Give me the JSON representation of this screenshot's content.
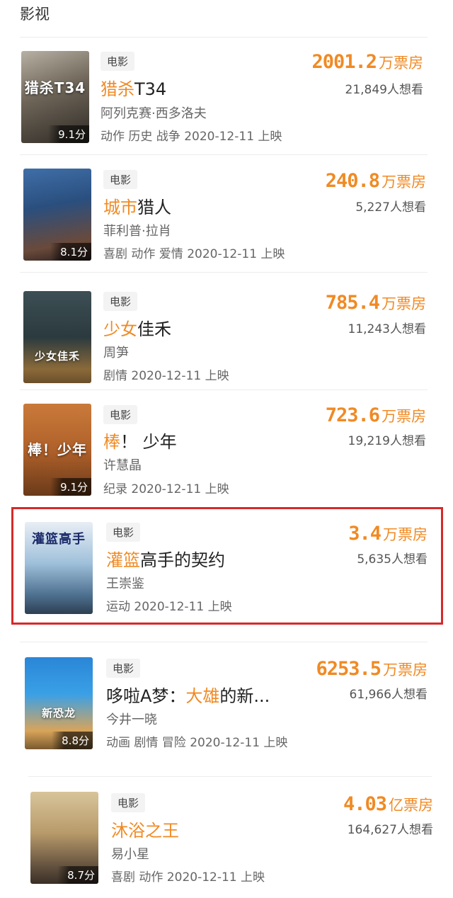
{
  "section": {
    "title": "影视"
  },
  "accent_color": "#f08a24",
  "highlight_color": "#d62a2a",
  "movies": [
    {
      "tag": "电影",
      "title_hl": "猎杀",
      "title_rest": "T34",
      "person": "阿列克赛·西多洛夫",
      "meta": "动作 历史 战争 2020-12-11 上映",
      "box_value": "2001.2",
      "box_unit": "万票房",
      "want": "21,849人想看",
      "rating": "9.1分",
      "poster_text": "猎杀T34"
    },
    {
      "tag": "电影",
      "title_hl": "城市",
      "title_rest": "猎人",
      "person": "菲利普·拉肖",
      "meta": "喜剧 动作 爱情 2020-12-11 上映",
      "box_value": "240.8",
      "box_unit": "万票房",
      "want": "5,227人想看",
      "rating": "8.1分",
      "poster_text": ""
    },
    {
      "tag": "电影",
      "title_hl": "少女",
      "title_rest": "佳禾",
      "person": "周笋",
      "meta": "剧情 2020-12-11 上映",
      "box_value": "785.4",
      "box_unit": "万票房",
      "want": "11,243人想看",
      "rating": "",
      "poster_text": "少女佳禾"
    },
    {
      "tag": "电影",
      "title_hl": "棒",
      "title_rest": "！ 少年",
      "person": "许慧晶",
      "meta": "纪录 2020-12-11 上映",
      "box_value": "723.6",
      "box_unit": "万票房",
      "want": "19,219人想看",
      "rating": "9.1分",
      "poster_text": "棒！少年"
    },
    {
      "tag": "电影",
      "title_hl": "灌篮",
      "title_rest": "高手的契约",
      "person": "王崇鉴",
      "meta": "运动 2020-12-11 上映",
      "box_value": "3.4",
      "box_unit": "万票房",
      "want": "5,635人想看",
      "rating": "",
      "poster_text": "灌篮高手"
    },
    {
      "tag": "电影",
      "title_pre": "哆啦A梦：",
      "title_hl": "大雄",
      "title_rest": "的新...",
      "person": "今井一晓",
      "meta": "动画 剧情 冒险 2020-12-11 上映",
      "box_value": "6253.5",
      "box_unit": "万票房",
      "want": "61,966人想看",
      "rating": "8.8分",
      "poster_text": "新恐龙"
    },
    {
      "tag": "电影",
      "title_hl": "沐浴之王",
      "title_rest": "",
      "person": "易小星",
      "meta": "喜剧 动作 2020-12-11 上映",
      "box_value": "4.03",
      "box_unit": "亿票房",
      "want": "164,627人想看",
      "rating": "8.7分",
      "poster_text": ""
    }
  ]
}
